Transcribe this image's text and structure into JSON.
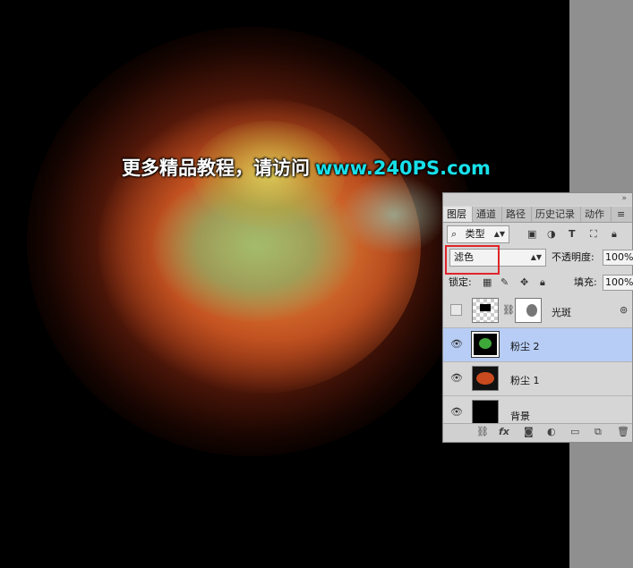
{
  "watermark": {
    "text": "更多精品教程，请访问",
    "url": "www.240PS.com"
  },
  "panel": {
    "collapse_arrows": "»",
    "close": "≡",
    "tabs": [
      "图层",
      "通道",
      "路径",
      "历史记录",
      "动作"
    ],
    "filter": {
      "icon": "⌕",
      "label": "类型"
    },
    "filter_icons": [
      "image-icon",
      "adjust-icon",
      "text-icon",
      "transform-icon",
      "lock-icon"
    ],
    "blend_mode": "滤色",
    "opacity_label": "不透明度:",
    "opacity_value": "100%",
    "lock_label": "锁定:",
    "fill_label": "填充:",
    "fill_value": "100%",
    "layers": [
      {
        "name": "光斑",
        "visible": false,
        "selected": false
      },
      {
        "name": "粉尘 2",
        "visible": true,
        "selected": true
      },
      {
        "name": "粉尘 1",
        "visible": true,
        "selected": false
      },
      {
        "name": "背景",
        "visible": true,
        "selected": false
      }
    ],
    "bottom_icons": [
      "link-icon",
      "fx-icon",
      "mask-icon",
      "adjustment-icon",
      "folder-icon",
      "new-layer-icon",
      "trash-icon"
    ],
    "fx_label": "fx"
  },
  "colors": {
    "selected_layer": "#b7cdf5",
    "highlight_box": "#e0242a",
    "url_color": "#18e0ea"
  }
}
